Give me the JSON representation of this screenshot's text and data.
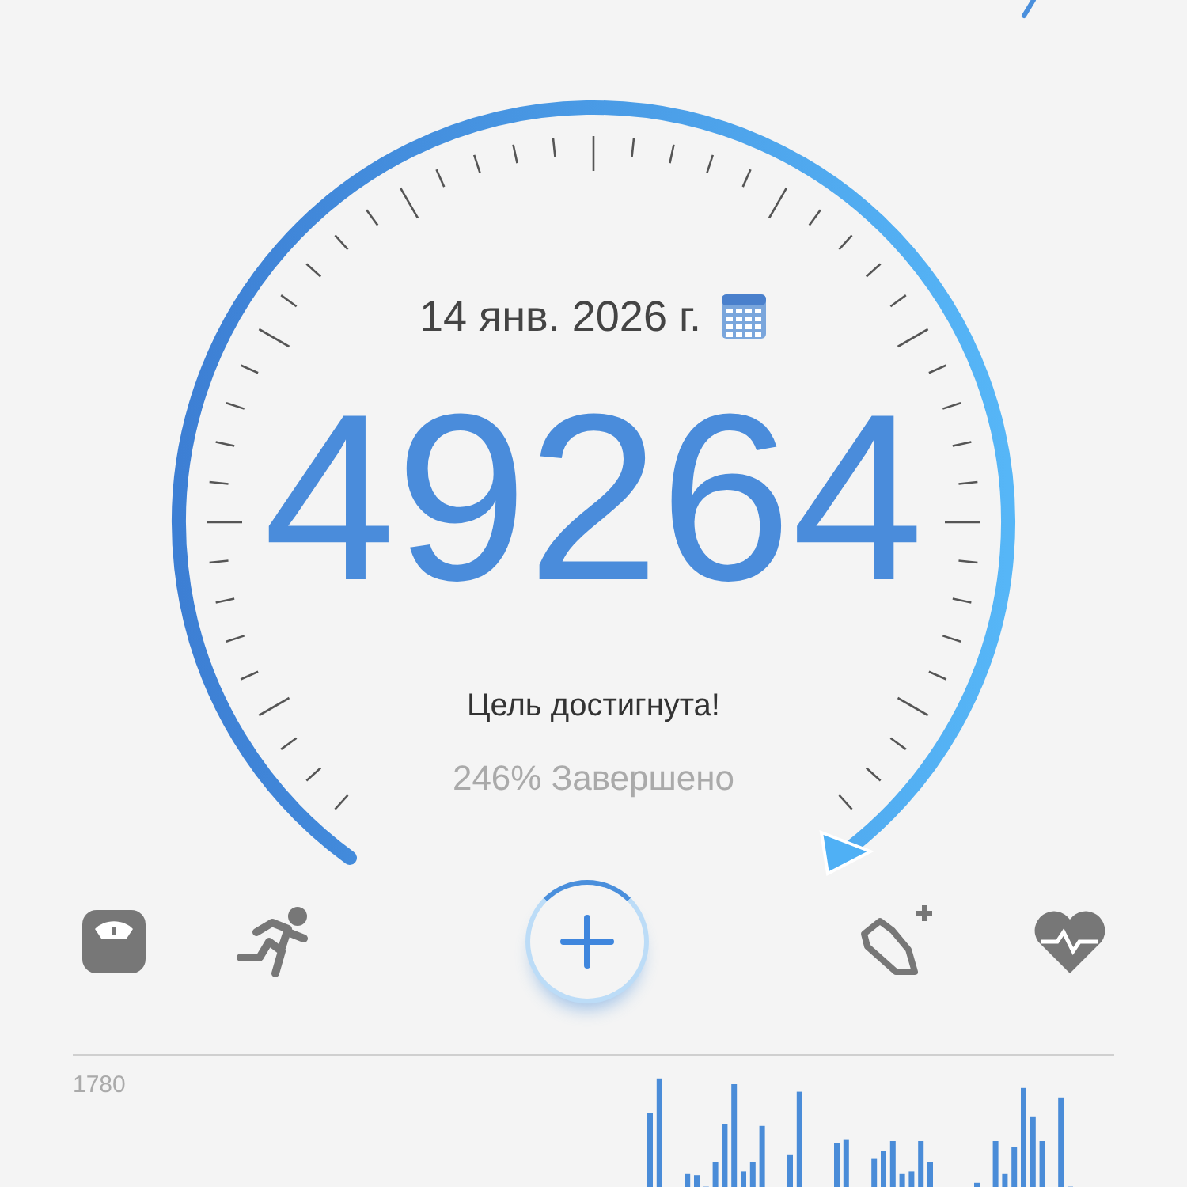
{
  "date": "14 янв. 2026 г.",
  "steps": "49264",
  "status": "Цель достигнута!",
  "progress": "246% Завершено",
  "chart": {
    "axis_label": "1780"
  }
}
